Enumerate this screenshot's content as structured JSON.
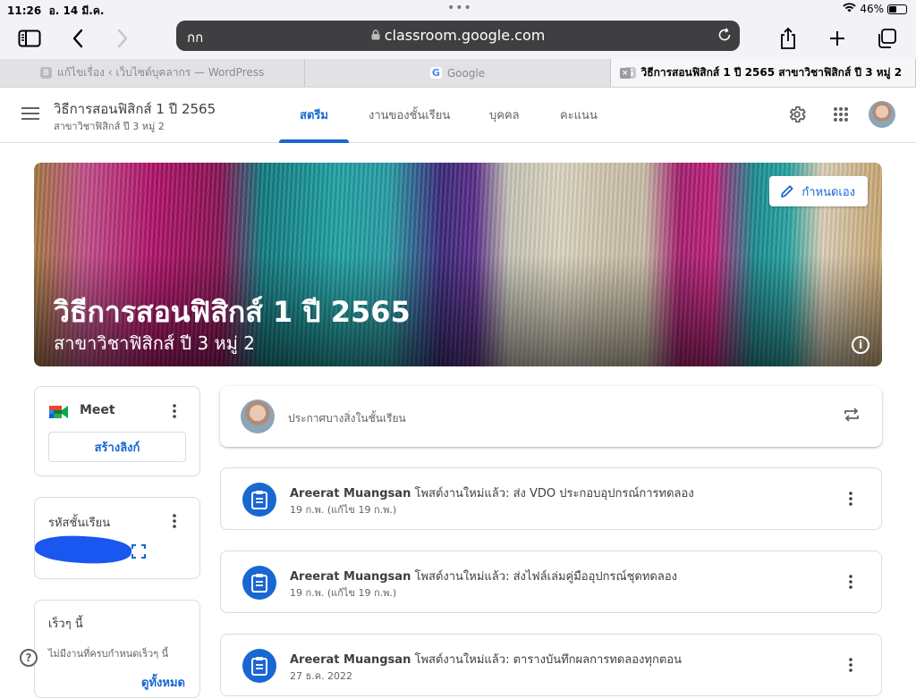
{
  "status_bar": {
    "time": "11:26",
    "date": "อ. 14 มี.ค.",
    "battery": "46%",
    "battery_level": 0.46
  },
  "browser": {
    "text_size_label": "กก",
    "url": "classroom.google.com",
    "tabs": [
      {
        "label": "แก้ไขเรื่อง ‹ เว็บไซต์บุคลากร — WordPress",
        "favicon": "B",
        "active": false
      },
      {
        "label": "Google",
        "favicon": "G",
        "active": false
      },
      {
        "label": "วิธีการสอนฟิสิกส์ 1 ปี 2565 สาขาวิชาฟิสิกส์ ปี 3 หมู่ 2",
        "favicon": "G",
        "active": true
      }
    ]
  },
  "header": {
    "class_name": "วิธีการสอนฟิสิกส์ 1 ปี 2565",
    "section": "สาขาวิชาฟิสิกส์ ปี 3 หมู่ 2",
    "tabs": [
      {
        "label": "สตรีม",
        "active": true
      },
      {
        "label": "งานของชั้นเรียน",
        "active": false
      },
      {
        "label": "บุคคล",
        "active": false
      },
      {
        "label": "คะแนน",
        "active": false
      }
    ],
    "accent_color": "#1967d2"
  },
  "banner": {
    "title": "วิธีการสอนฟิสิกส์ 1 ปี 2565",
    "subtitle": "สาขาวิชาฟิสิกส์ ปี 3 หมู่ 2",
    "customize_label": "กำหนดเอง"
  },
  "sidebar": {
    "meet": {
      "label": "Meet",
      "create_link_label": "สร้างลิงก์"
    },
    "class_code": {
      "title": "รหัสชั้นเรียน",
      "value": ""
    },
    "upcoming": {
      "title": "เร็วๆ นี้",
      "empty_text": "ไม่มีงานที่ครบกำหนดเร็วๆ นี้",
      "view_all_label": "ดูทั้งหมด"
    }
  },
  "stream": {
    "announce_placeholder": "ประกาศบางสิ่งในชั้นเรียน",
    "posts": [
      {
        "author": "Areerat Muangsan",
        "text": "โพสต์งานใหม่แล้ว: ส่ง VDO ประกอบอุปกรณ์การทดลอง",
        "date": "19 ก.พ. (แก้ไข 19 ก.พ.)"
      },
      {
        "author": "Areerat Muangsan",
        "text": "โพสต์งานใหม่แล้ว: ส่งไฟล์เล่มคู่มืออุปกรณ์ชุดทดลอง",
        "date": "19 ก.พ. (แก้ไข 19 ก.พ.)"
      },
      {
        "author": "Areerat Muangsan",
        "text": "โพสต์งานใหม่แล้ว: ตารางบันทึกผลการทดลองทุกตอน",
        "date": "27 ธ.ค. 2022"
      }
    ]
  }
}
